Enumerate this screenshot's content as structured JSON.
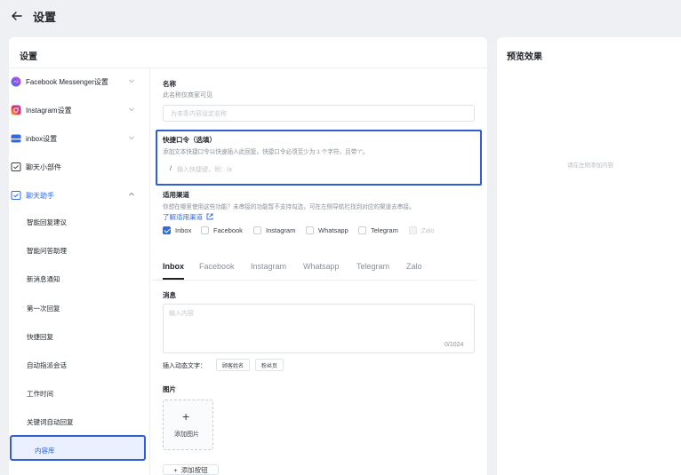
{
  "header": {
    "title": "设置"
  },
  "left_card": {
    "title": "设置"
  },
  "preview": {
    "title": "预览效果",
    "empty_text": "请在左侧添加内容"
  },
  "sidebar": {
    "items": [
      {
        "label": "Facebook Messenger设置",
        "icon": "messenger-icon",
        "expandable": true
      },
      {
        "label": "Instagram设置",
        "icon": "instagram-icon",
        "expandable": true
      },
      {
        "label": "inbox设置",
        "icon": "inbox-icon",
        "expandable": true
      },
      {
        "label": "聊天小部件",
        "icon": "widget-icon",
        "expandable": false
      },
      {
        "label": "聊天助手",
        "icon": "assistant-icon",
        "expandable": true,
        "expanded": true
      }
    ],
    "sub_items": [
      "智能回复建议",
      "智能问答助理",
      "新消息通知",
      "第一次回复",
      "快捷回复",
      "自动指派会话",
      "工作时间",
      "关键词自动回复"
    ],
    "active_sub_item": "内容库"
  },
  "form": {
    "name": {
      "label": "名称",
      "hint": "此名称仅商家可见",
      "placeholder": "为本条内容设定名称"
    },
    "shortcut": {
      "label": "快捷口令（选填）",
      "hint": "添加文本快捷口令以快速插入此回复。快捷口令必须至少为 1 个字符，且带\"/\"。",
      "prefix": "/",
      "placeholder": "输入快捷键，例：/a"
    },
    "channels": {
      "label": "适用渠道",
      "hint": "你想在哪里使用这些功能？未串接的功能暂不支持勾选，可在左侧导航栏找到对应的渠道去串接。",
      "link": "了解适用渠道",
      "options": [
        {
          "label": "Inbox",
          "checked": true,
          "disabled": false
        },
        {
          "label": "Facebook",
          "checked": false,
          "disabled": false
        },
        {
          "label": "Instagram",
          "checked": false,
          "disabled": false
        },
        {
          "label": "Whatsapp",
          "checked": false,
          "disabled": false
        },
        {
          "label": "Telegram",
          "checked": false,
          "disabled": false
        },
        {
          "label": "Zalo",
          "checked": false,
          "disabled": true
        }
      ]
    },
    "tabs": [
      "Inbox",
      "Facebook",
      "Instagram",
      "Whatsapp",
      "Telegram",
      "Zalo"
    ],
    "active_tab": "Inbox",
    "message": {
      "label": "消息",
      "placeholder": "输入内容",
      "counter": "0/1024"
    },
    "dynamic": {
      "label": "插入动态文字：",
      "chips": [
        "顾客姓名",
        "粉丝页"
      ]
    },
    "image": {
      "label": "图片",
      "upload_label": "添加图片"
    },
    "add_button": "添加按钮"
  },
  "colors": {
    "accent": "#2f6be6",
    "highlight_border": "#2f5fd0",
    "background": "#eef0f3"
  }
}
